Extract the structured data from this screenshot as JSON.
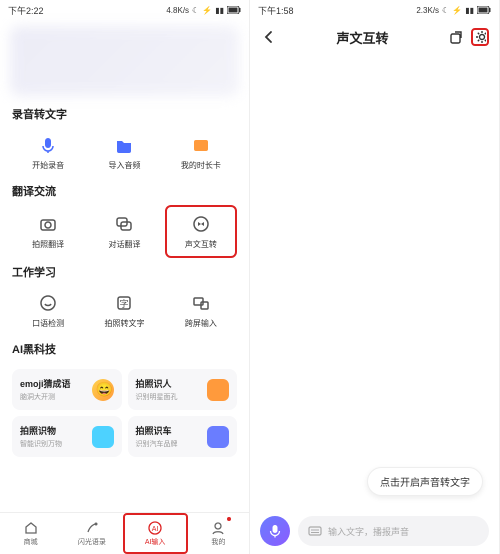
{
  "left": {
    "status": {
      "time": "下午2:22",
      "speed": "4.8K/s"
    },
    "sections": {
      "rec": {
        "title": "录音转文字",
        "items": [
          {
            "label": "开始录音"
          },
          {
            "label": "导入音频"
          },
          {
            "label": "我的时长卡"
          }
        ]
      },
      "trans": {
        "title": "翻译交流",
        "items": [
          {
            "label": "拍照翻译"
          },
          {
            "label": "对话翻译"
          },
          {
            "label": "声文互转"
          }
        ]
      },
      "work": {
        "title": "工作学习",
        "items": [
          {
            "label": "口语检测"
          },
          {
            "label": "拍照转文字"
          },
          {
            "label": "跨屏输入"
          }
        ]
      },
      "ai": {
        "title": "AI黑科技",
        "cards": [
          {
            "title": "emoji猜成语",
            "sub": "脑洞大开测"
          },
          {
            "title": "拍照识人",
            "sub": "识别明星面孔"
          },
          {
            "title": "拍照识物",
            "sub": "智能识别万物"
          },
          {
            "title": "拍照识车",
            "sub": "识别汽车品牌"
          }
        ]
      }
    },
    "nav": [
      {
        "label": "商城"
      },
      {
        "label": "闪光语录"
      },
      {
        "label": "AI输入"
      },
      {
        "label": "我的"
      }
    ]
  },
  "right": {
    "status": {
      "time": "下午1:58",
      "speed": "2.3K/s"
    },
    "title": "声文互转",
    "hint": "点击开启声音转文字",
    "placeholder": "输入文字，播报声音"
  }
}
